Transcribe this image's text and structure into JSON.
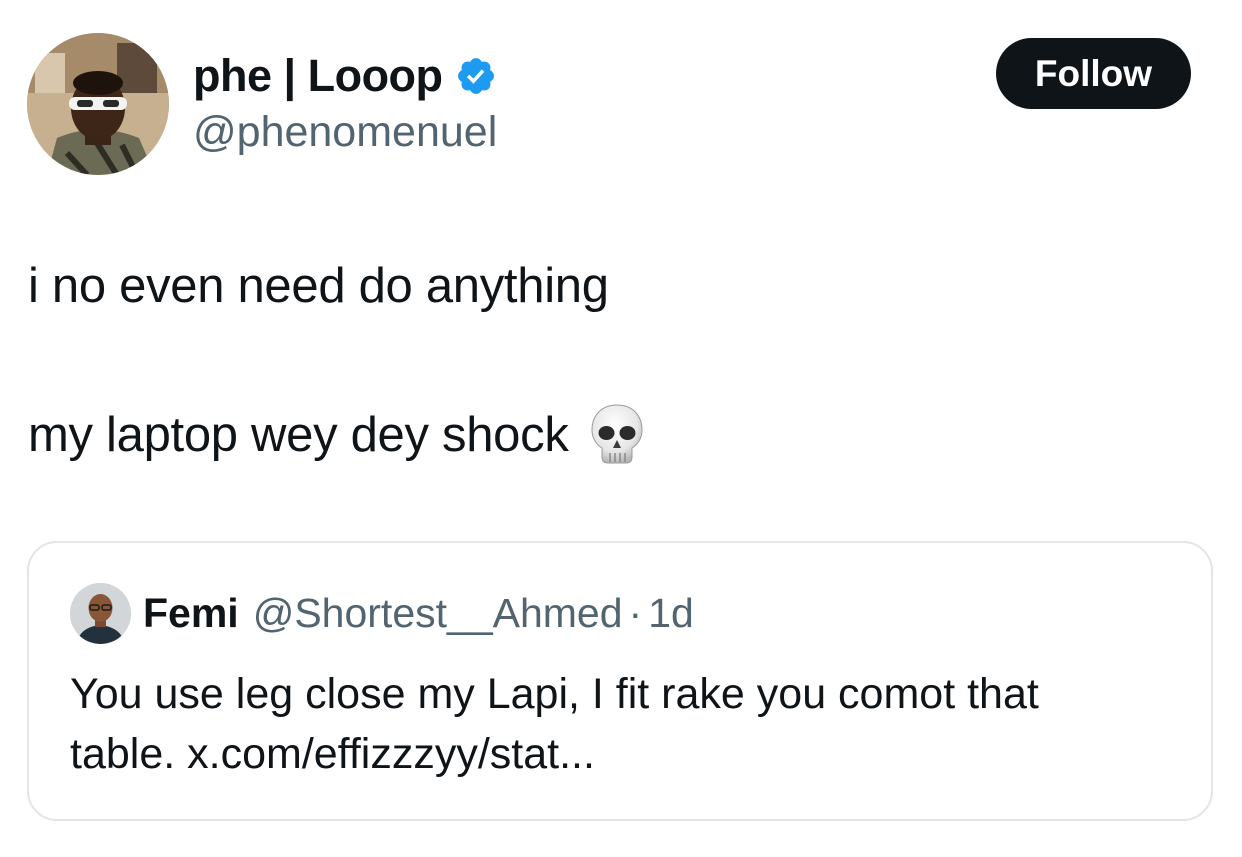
{
  "author": {
    "display_name": "phe | Looop",
    "handle": "@phenomenuel",
    "verified_icon": "verified-badge-icon",
    "accent_color": "#1d9bf0"
  },
  "follow_button": {
    "label": "Follow"
  },
  "tweet": {
    "lines": [
      "i no even need do anything",
      "my laptop wey dey shock"
    ],
    "emoji": "skull-emoji"
  },
  "quoted_tweet": {
    "display_name": "Femi",
    "handle": "@Shortest__Ahmed",
    "separator": "·",
    "time": "1d",
    "text_lines": [
      "You use leg close my Lapi, I fit rake you comot that",
      "table. x.com/effizzzyy/stat..."
    ]
  }
}
